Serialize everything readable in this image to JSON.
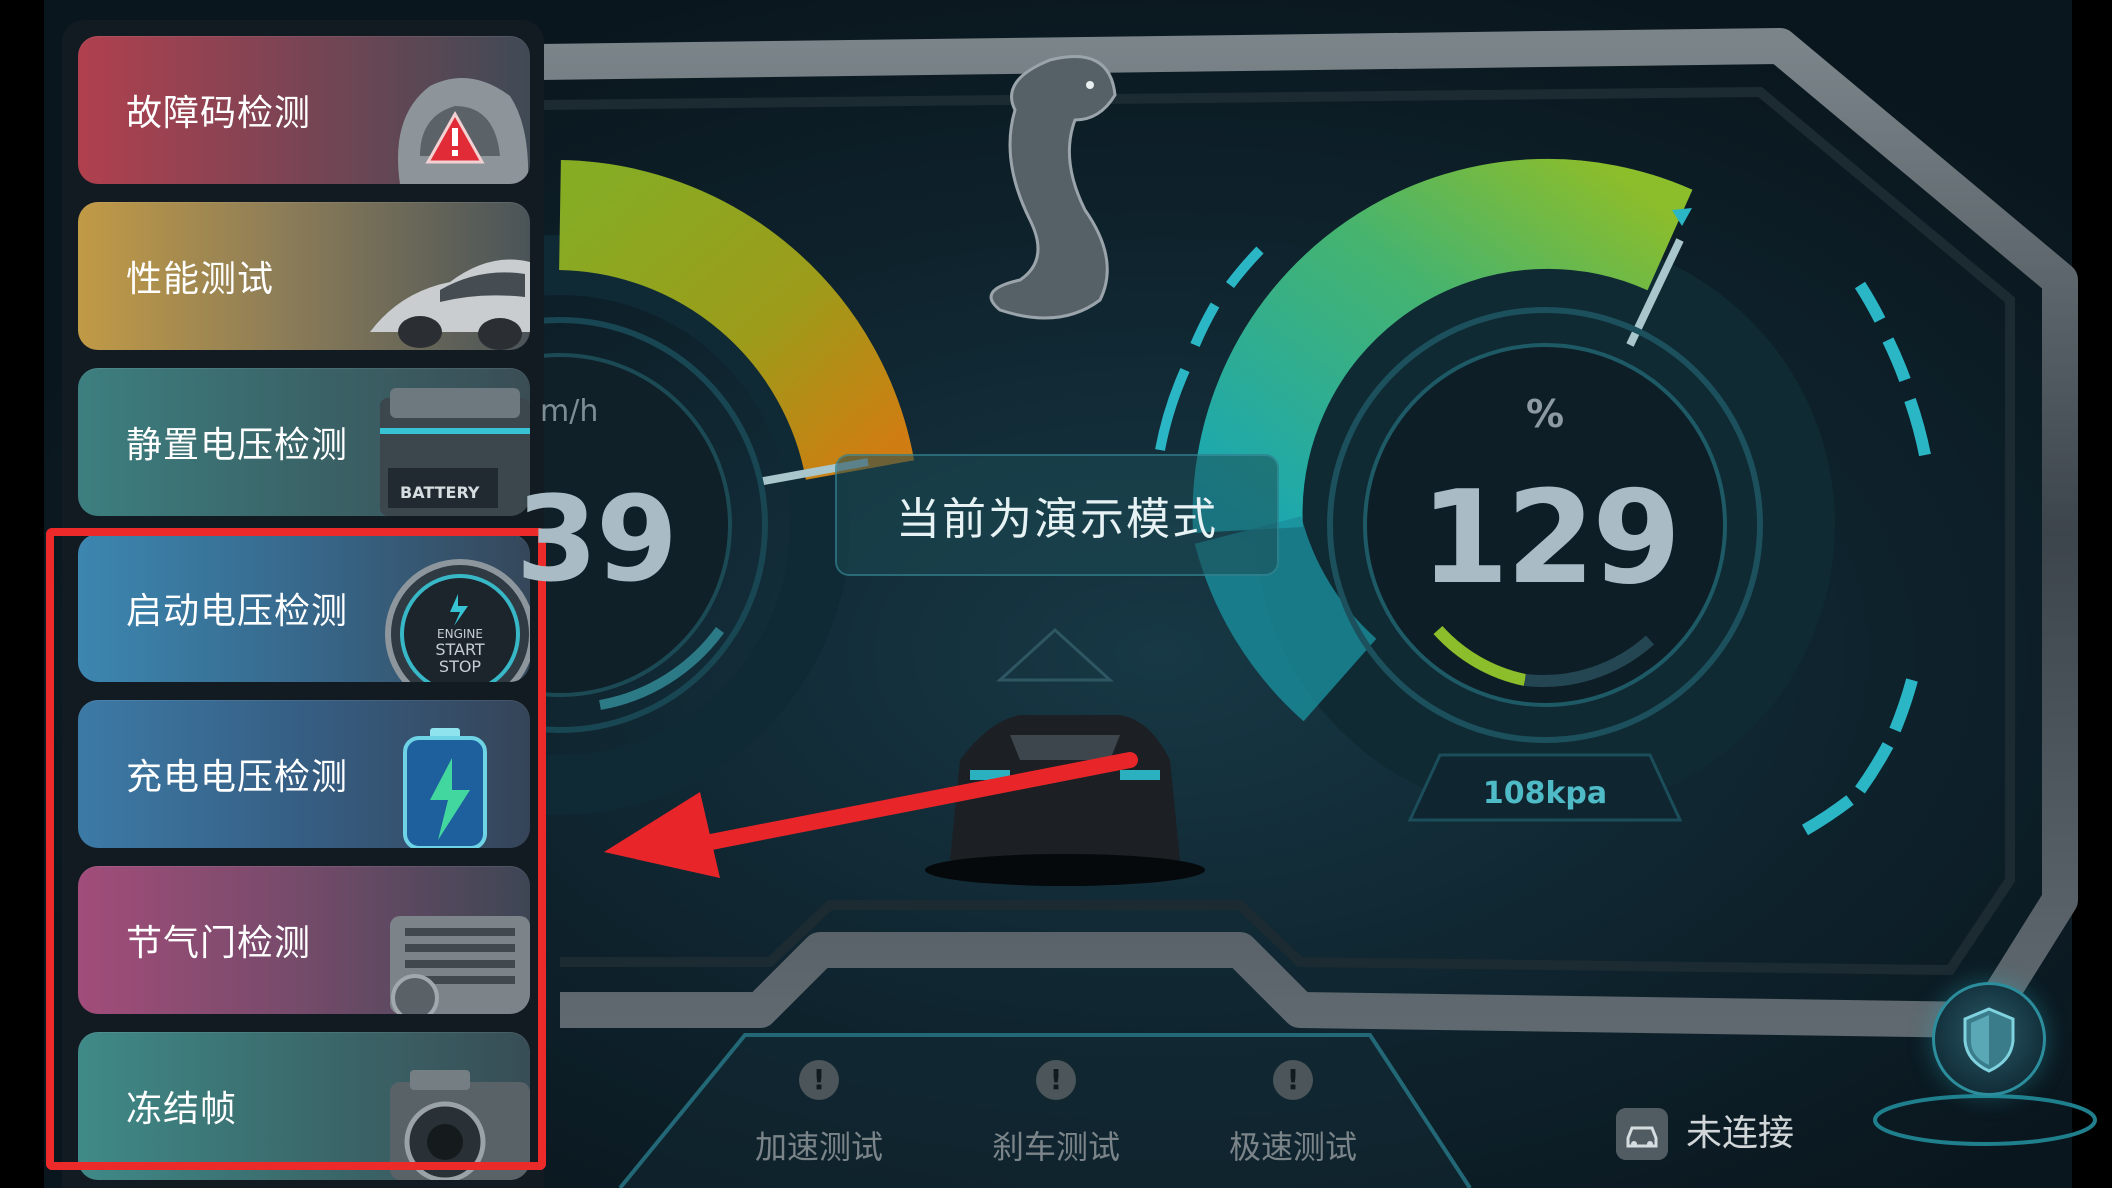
{
  "menu": {
    "items": [
      {
        "label": "故障码检测",
        "icon": "car-warning-icon"
      },
      {
        "label": "性能测试",
        "icon": "sports-car-icon"
      },
      {
        "label": "静置电压检测",
        "icon": "battery-icon"
      },
      {
        "label": "启动电压检测",
        "icon": "engine-start-stop-icon"
      },
      {
        "label": "充电电压检测",
        "icon": "charging-battery-icon"
      },
      {
        "label": "节气门检测",
        "icon": "throttle-body-icon"
      },
      {
        "label": "冻结帧",
        "icon": "camera-icon"
      }
    ],
    "battery_text": "BATTERY",
    "engine_button_text": [
      "ENGINE",
      "START",
      "STOP"
    ]
  },
  "dashboard": {
    "demo_banner": "当前为演示模式",
    "left_gauge": {
      "unit": "m/h",
      "value": "39"
    },
    "right_gauge": {
      "unit": "%",
      "value": "129",
      "pressure": "108kpa"
    }
  },
  "bottom": {
    "tests": [
      {
        "label": "加速测试",
        "icon": "exclamation-icon"
      },
      {
        "label": "刹车测试",
        "icon": "exclamation-icon"
      },
      {
        "label": "极速测试",
        "icon": "exclamation-icon"
      }
    ],
    "connection_status": "未连接"
  },
  "annotation": {
    "highlight_color": "#ec2a2a",
    "arrow_color": "#e8262a"
  },
  "colors": {
    "accent_teal": "#2bb6c6",
    "gauge_green": "#8bbb2f",
    "gauge_orange": "#d08a14"
  }
}
